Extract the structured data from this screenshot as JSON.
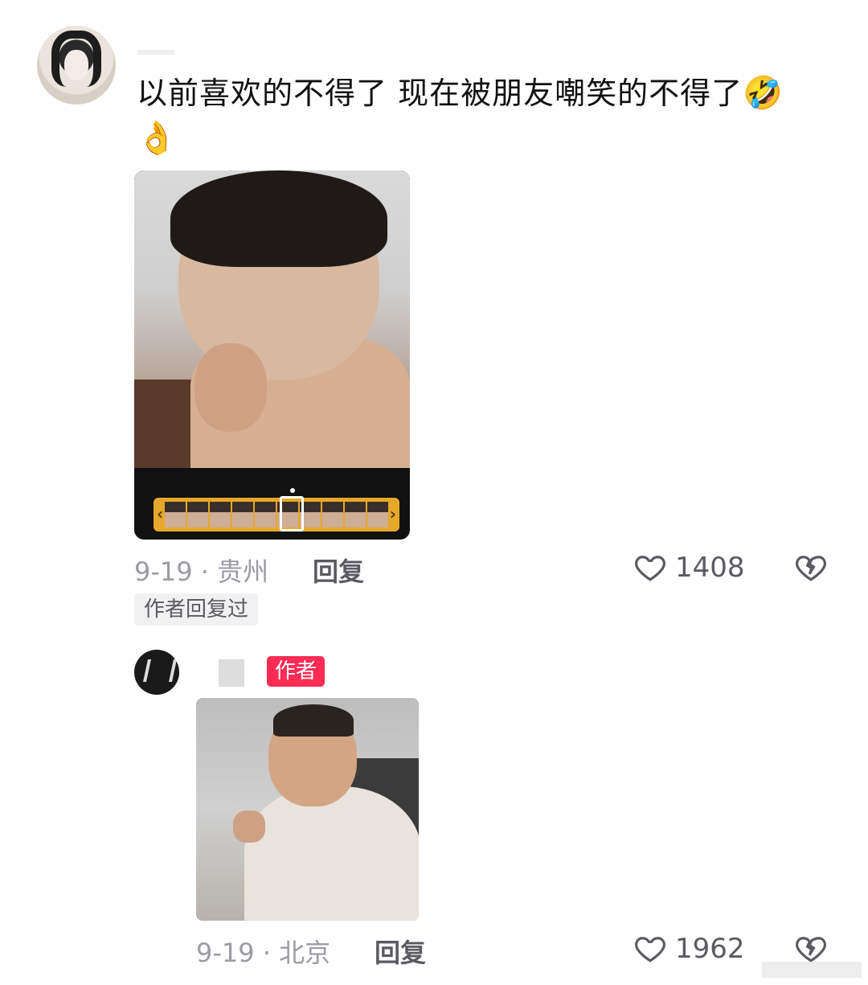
{
  "comment": {
    "text": "以前喜欢的不得了 现在被朋友嘲笑的不得了",
    "emoji_1": "🤣",
    "emoji_2": "👌",
    "meta": "9-19 · 贵州",
    "reply_label": "回复",
    "likes": "1408",
    "author_replied_tag": "作者回复过"
  },
  "reply": {
    "author_badge": "作者",
    "meta": "9-19 · 北京",
    "reply_label": "回复",
    "likes": "1962"
  },
  "icons": {
    "like": "heart-outline-icon",
    "dislike": "broken-heart-icon"
  },
  "colors": {
    "author_badge_bg": "#fe2c55",
    "timeline": "#e5a82a"
  }
}
